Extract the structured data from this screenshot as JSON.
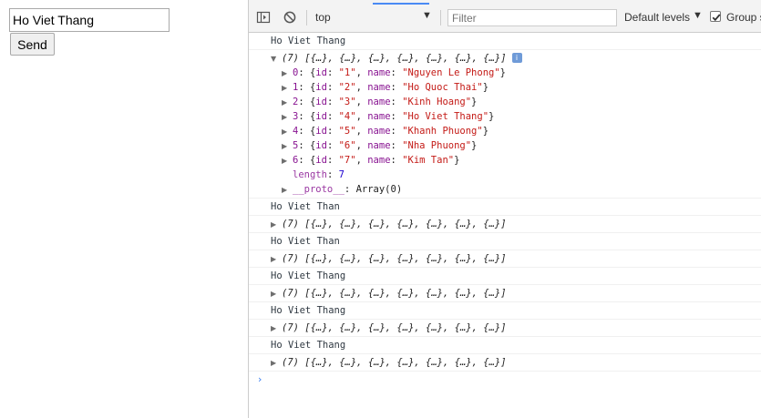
{
  "app": {
    "input_value": "Ho Viet Thang",
    "send_label": "Send"
  },
  "toolbar": {
    "context": "top",
    "filter_placeholder": "Filter",
    "levels_label": "Default levels",
    "group_label": "Group s",
    "group_checked": true
  },
  "console": {
    "entries": [
      {
        "label": "Ho Viet Thang",
        "array_summary": "(7) [{…}, {…}, {…}, {…}, {…}, {…}, {…}]",
        "expanded": true,
        "items": [
          {
            "index": "0",
            "id": "\"1\"",
            "name": "\"Nguyen Le Phong\""
          },
          {
            "index": "1",
            "id": "\"2\"",
            "name": "\"Ho Quoc Thai\""
          },
          {
            "index": "2",
            "id": "\"3\"",
            "name": "\"Kinh Hoang\""
          },
          {
            "index": "3",
            "id": "\"4\"",
            "name": "\"Ho Viet Thang\""
          },
          {
            "index": "4",
            "id": "\"5\"",
            "name": "\"Khanh Phuong\""
          },
          {
            "index": "5",
            "id": "\"6\"",
            "name": "\"Nha Phuong\""
          },
          {
            "index": "6",
            "id": "\"7\"",
            "name": "\"Kim Tan\""
          }
        ],
        "length_key": "length",
        "length_value": "7",
        "proto_key": "__proto__",
        "proto_value": "Array(0)"
      },
      {
        "label": "Ho Viet Than",
        "array_summary": "(7) [{…}, {…}, {…}, {…}, {…}, {…}, {…}]"
      },
      {
        "label": "Ho Viet Than",
        "array_summary": "(7) [{…}, {…}, {…}, {…}, {…}, {…}, {…}]"
      },
      {
        "label": "Ho Viet Thang",
        "array_summary": "(7) [{…}, {…}, {…}, {…}, {…}, {…}, {…}]"
      },
      {
        "label": "Ho Viet Thang",
        "array_summary": "(7) [{…}, {…}, {…}, {…}, {…}, {…}, {…}]"
      },
      {
        "label": "Ho Viet Thang",
        "array_summary": "(7) [{…}, {…}, {…}, {…}, {…}, {…}, {…}]"
      }
    ],
    "prompt_symbol": "›"
  },
  "colors": {
    "string": "#c41a16",
    "number": "#1c00cf",
    "key": "#881391",
    "accent": "#4a8af4"
  }
}
